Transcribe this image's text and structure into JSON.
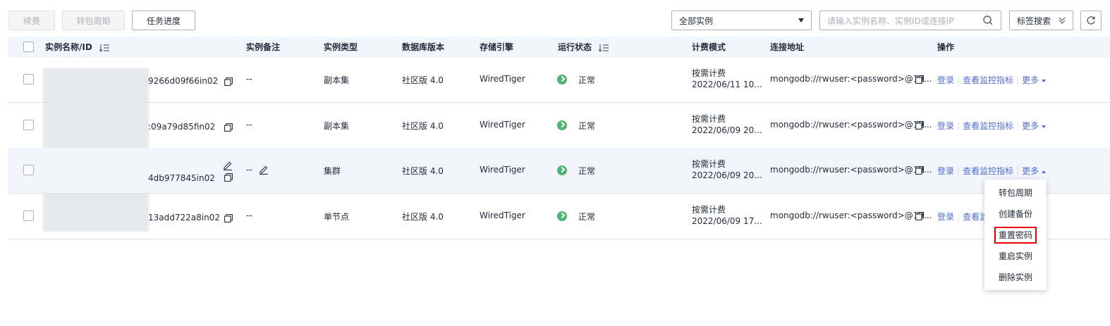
{
  "toolbar": {
    "renew_label": "续费",
    "convert_label": "转包周期",
    "task_label": "任务进度",
    "filter_value": "全部实例",
    "search_placeholder": "请输入实例名称、实例ID或连接IP",
    "tag_search_label": "标签搜索"
  },
  "table": {
    "headers": {
      "name": "实例名称/ID",
      "remark": "实例备注",
      "type": "实例类型",
      "version": "数据库版本",
      "engine": "存储引擎",
      "status": "运行状态",
      "billing": "计费模式",
      "address": "连接地址",
      "actions": "操作"
    },
    "rows": [
      {
        "id_suffix": "9266d09f66in02",
        "remark": "--",
        "type": "副本集",
        "version": "社区版 4.0",
        "engine": "WiredTiger",
        "status": "正常",
        "billing_mode": "按需计费",
        "billing_date": "2022/06/11 10...",
        "address": "mongodb://rwuser:<password>@19...",
        "action_login": "登录",
        "action_monitor": "查看监控指标",
        "action_more": "更多"
      },
      {
        "id_suffix": ":09a79d85fin02",
        "remark": "--",
        "type": "副本集",
        "version": "社区版 4.0",
        "engine": "WiredTiger",
        "status": "正常",
        "billing_mode": "按需计费",
        "billing_date": "2022/06/09 20...",
        "address": "mongodb://rwuser:<password>@19...",
        "action_login": "登录",
        "action_monitor": "查看监控指标",
        "action_more": "更多"
      },
      {
        "id_suffix": "4db977845in02",
        "remark": "--",
        "type": "集群",
        "version": "社区版 4.0",
        "engine": "WiredTiger",
        "status": "正常",
        "billing_mode": "按需计费",
        "billing_date": "2022/06/09 20...",
        "address": "mongodb://rwuser:<password>@19...",
        "action_login": "登录",
        "action_monitor": "查看监控指标",
        "action_more": "更多"
      },
      {
        "id_suffix": "13add722a8in02",
        "remark": "--",
        "type": "单节点",
        "version": "社区版 4.0",
        "engine": "WiredTiger",
        "status": "正常",
        "billing_mode": "按需计费",
        "billing_date": "2022/06/09 17...",
        "address": "mongodb://rwuser:<password>@19...",
        "action_login": "登录",
        "action_monitor": "查看监",
        "action_more": ""
      }
    ]
  },
  "more_menu": {
    "items": [
      "转包周期",
      "创建备份",
      "重置密码",
      "重启实例",
      "删除实例"
    ],
    "highlighted": "重置密码"
  },
  "colors": {
    "link": "#526ecc",
    "status_ok": "#50b371",
    "highlight_border": "#e60000",
    "header_bg": "#f2f5fc"
  }
}
